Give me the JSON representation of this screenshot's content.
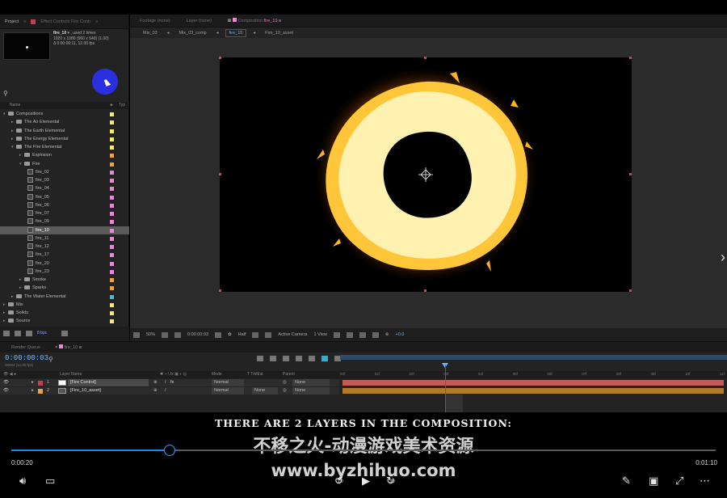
{
  "project_panel": {
    "tab_project": "Project",
    "tab_effects": "Effect Controls Fire Contr",
    "selected_name": "fire_10",
    "selected_used": ", used 2 times",
    "selected_dims": "1920 x 1080  (960 x 540) (1.00)",
    "selected_duration": "Δ 0:00:00:11, 12.00 fps",
    "col_name": "Name",
    "col_type": "Typ",
    "tree": [
      {
        "label": "Compositions",
        "depth": 0,
        "kind": "folder",
        "open": true,
        "color": "#f1e97a"
      },
      {
        "label": "The Air Elemental",
        "depth": 1,
        "kind": "folder",
        "open": false,
        "color": "#f1e97a"
      },
      {
        "label": "The Earth Elemental",
        "depth": 1,
        "kind": "folder",
        "open": false,
        "color": "#f1e97a"
      },
      {
        "label": "The Energy Elemental",
        "depth": 1,
        "kind": "folder",
        "open": false,
        "color": "#f1e97a"
      },
      {
        "label": "The Fire Elemental",
        "depth": 1,
        "kind": "folder",
        "open": true,
        "color": "#f1e97a"
      },
      {
        "label": "Explosion",
        "depth": 2,
        "kind": "folder",
        "open": false,
        "color": "#e7a24a"
      },
      {
        "label": "Fire",
        "depth": 2,
        "kind": "folder",
        "open": true,
        "color": "#e7a24a"
      },
      {
        "label": "fire_02",
        "depth": 3,
        "kind": "comp",
        "color": "#e58bd6"
      },
      {
        "label": "fire_03",
        "depth": 3,
        "kind": "comp",
        "color": "#e58bd6"
      },
      {
        "label": "fire_04",
        "depth": 3,
        "kind": "comp",
        "color": "#e58bd6"
      },
      {
        "label": "fire_05",
        "depth": 3,
        "kind": "comp",
        "color": "#e58bd6"
      },
      {
        "label": "fire_06",
        "depth": 3,
        "kind": "comp",
        "color": "#e58bd6"
      },
      {
        "label": "fire_07",
        "depth": 3,
        "kind": "comp",
        "color": "#e58bd6"
      },
      {
        "label": "fire_09",
        "depth": 3,
        "kind": "comp",
        "color": "#e58bd6"
      },
      {
        "label": "fire_10",
        "depth": 3,
        "kind": "comp",
        "color": "#e58bd6",
        "selected": true
      },
      {
        "label": "fire_11",
        "depth": 3,
        "kind": "comp",
        "color": "#e58bd6"
      },
      {
        "label": "fire_12",
        "depth": 3,
        "kind": "comp",
        "color": "#e58bd6"
      },
      {
        "label": "fire_17",
        "depth": 3,
        "kind": "comp",
        "color": "#e58bd6"
      },
      {
        "label": "fire_20",
        "depth": 3,
        "kind": "comp",
        "color": "#e58bd6"
      },
      {
        "label": "fire_23",
        "depth": 3,
        "kind": "comp",
        "color": "#e58bd6"
      },
      {
        "label": "Smoke",
        "depth": 2,
        "kind": "folder",
        "open": false,
        "color": "#e7a24a"
      },
      {
        "label": "Sparks",
        "depth": 2,
        "kind": "folder",
        "open": false,
        "color": "#e7a24a"
      },
      {
        "label": "The Water Elemental",
        "depth": 1,
        "kind": "folder",
        "open": false,
        "color": "#4fb9c9"
      },
      {
        "label": "Mix",
        "depth": 0,
        "kind": "folder",
        "open": false,
        "color": "#f1e97a"
      },
      {
        "label": "Solids",
        "depth": 0,
        "kind": "folder",
        "open": false,
        "color": "#f1e97a"
      },
      {
        "label": "Source",
        "depth": 0,
        "kind": "folder",
        "open": false,
        "color": "#f1e97a"
      },
      {
        "label": "Transitions",
        "depth": 0,
        "kind": "folder",
        "open": false,
        "color": "#c9d9f0"
      }
    ],
    "bpc": "8 bpc"
  },
  "viewer": {
    "tab_footage": "Footage (none)",
    "tab_layer": "Layer (none)",
    "tab_composition": "Composition",
    "tab_composition_name": "fire_10",
    "breadcrumbs": [
      "Mix_03",
      "Mix_03_comp",
      "fire_10",
      "Fire_10_asset"
    ],
    "zoom": "50%",
    "timecode": "0:00:00:03",
    "resolution": "Half",
    "camera": "Active Camera",
    "views": "1 View",
    "exposure": "+0.0"
  },
  "timeline": {
    "tab_render": "Render Queue",
    "tab_comp": "fire_10",
    "timecode": "0:00:00:03",
    "timecode_sub": "00003 (12.00 fps)",
    "col_layer_name": "Layer Name",
    "col_mode": "Mode",
    "col_trkmat": "T  TrkMat",
    "col_parent": "Parent",
    "ruler_ticks": [
      "00f",
      "01f",
      "02f",
      "03f",
      "04f",
      "05f",
      "06f",
      "07f",
      "08f",
      "09f",
      "10f",
      "11f"
    ],
    "layers": [
      {
        "num": "1",
        "name": "[Fire Control]",
        "mode": "Normal",
        "trkmat": "",
        "parent": "None",
        "label_color": "#c04050",
        "bar_color": "#c35a5a"
      },
      {
        "num": "2",
        "name": "[Fire_10_asset]",
        "mode": "Normal",
        "trkmat": "None",
        "parent": "None",
        "label_color": "#e7a24a",
        "bar_color": "#b37a2c"
      }
    ]
  },
  "player": {
    "subtitle": "THERE ARE 2 LAYERS IN THE COMPOSITION:",
    "watermark_line1": "不移之火-动漫游戏美术资源",
    "watermark_line2": "www.byzhihuo.com",
    "time_current": "0:00:20",
    "time_total": "0:01:10",
    "progress_fraction": 0.225,
    "skip_back": "10",
    "skip_forward": "30",
    "accent": "#1e88e5"
  }
}
